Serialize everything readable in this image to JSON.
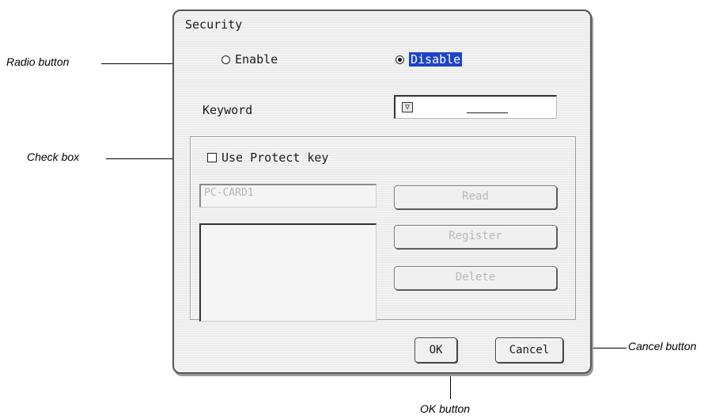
{
  "callouts": {
    "radio": "Radio button",
    "check": "Check box",
    "ok": "OK button",
    "cancel": "Cancel button"
  },
  "dialog": {
    "title": "Security",
    "radios": [
      {
        "label": "Enable",
        "selected": false
      },
      {
        "label": "Disable",
        "selected": true
      }
    ],
    "keyword_label": "Keyword",
    "keyword_dropdown_icon": "▽",
    "protect_key_label": "Use Protect key",
    "protect_key_checked": false,
    "card_field_value": "PC-CARD1",
    "buttons": {
      "read": "Read",
      "register": "Register",
      "delete": "Delete",
      "ok": "OK",
      "cancel": "Cancel"
    }
  },
  "colors": {
    "selection": "#1c43c8"
  }
}
